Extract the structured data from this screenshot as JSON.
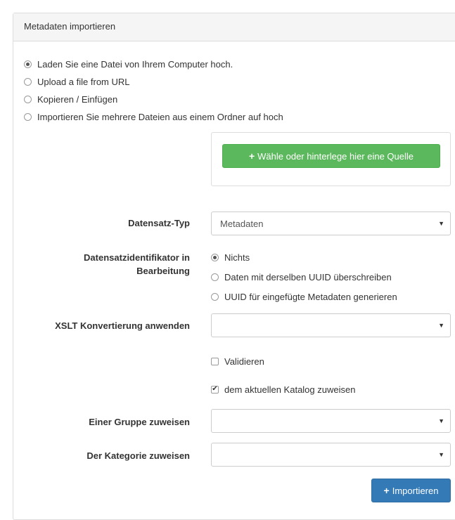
{
  "panel": {
    "title": "Metadaten importieren"
  },
  "source_options": [
    {
      "label": "Laden Sie eine Datei von Ihrem Computer hoch.",
      "checked": true
    },
    {
      "label": "Upload a file from URL",
      "checked": false
    },
    {
      "label": "Kopieren / Einfügen",
      "checked": false
    },
    {
      "label": "Importieren Sie mehrere Dateien aus einem Ordner auf hoch",
      "checked": false
    }
  ],
  "source_button": {
    "icon": "plus-icon",
    "label": "Wähle oder hinterlege hier eine Quelle"
  },
  "record_type": {
    "label": "Datensatz-Typ",
    "value": "Metadaten"
  },
  "uuid_processing": {
    "label_line1": "Datensatzidentifikator in",
    "label_line2": "Bearbeitung",
    "options": [
      {
        "label": "Nichts",
        "checked": true
      },
      {
        "label": "Daten mit derselben UUID überschreiben",
        "checked": false
      },
      {
        "label": "UUID für eingefügte Metadaten generieren",
        "checked": false
      }
    ]
  },
  "xslt": {
    "label": "XSLT Konvertierung anwenden",
    "value": ""
  },
  "validate": {
    "label": "Validieren",
    "checked": false
  },
  "assign_catalog": {
    "label": "dem aktuellen Katalog zuweisen",
    "checked": true
  },
  "group": {
    "label": "Einer Gruppe zuweisen",
    "value": ""
  },
  "category": {
    "label": "Der Kategorie zuweisen",
    "value": ""
  },
  "import_button": {
    "icon": "plus-icon",
    "label": "Importieren"
  },
  "colors": {
    "success": "#5cb85c",
    "primary": "#337ab7",
    "border": "#dddddd"
  }
}
